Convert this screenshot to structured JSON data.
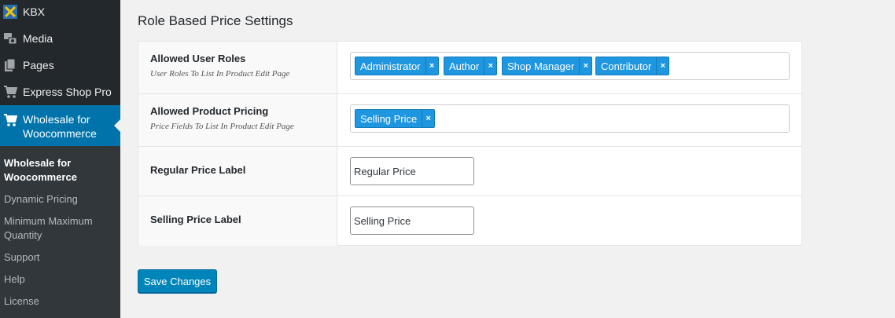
{
  "sidebar": {
    "items": [
      {
        "label": "KBX",
        "icon": "kbx-logo-icon"
      },
      {
        "label": "Media",
        "icon": "media-icon"
      },
      {
        "label": "Pages",
        "icon": "pages-icon"
      },
      {
        "label": "Express Shop Pro",
        "icon": "cart-icon"
      },
      {
        "label": "Wholesale for Woocommerce",
        "icon": "cart-icon"
      }
    ],
    "submenu": [
      "Wholesale for Woocommerce",
      "Dynamic Pricing",
      "Minimum Maximum Quantity",
      "Support",
      "Help",
      "License"
    ]
  },
  "page": {
    "title": "Role Based Price Settings",
    "save_label": "Save Changes"
  },
  "form": {
    "user_roles": {
      "label": "Allowed User Roles",
      "desc": "User Roles To List In Product Edit Page",
      "tags": [
        "Administrator",
        "Author",
        "Shop Manager",
        "Contributor"
      ]
    },
    "product_pricing": {
      "label": "Allowed Product Pricing",
      "desc": "Price Fields To List In Product Edit Page",
      "tags": [
        "Selling Price"
      ]
    },
    "regular_label": {
      "label": "Regular Price Label",
      "value": "Regular Price"
    },
    "selling_label": {
      "label": "Selling Price Label",
      "value": "Selling Price"
    }
  },
  "tag_remove_glyph": "×",
  "colors": {
    "sidebar_bg": "#23282d",
    "submenu_bg": "#32373c",
    "accent": "#0073aa",
    "tag_bg": "#1e96e0",
    "button_bg": "#0085ba"
  }
}
